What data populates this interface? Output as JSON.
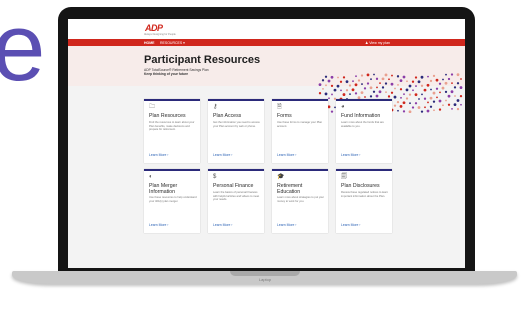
{
  "background_letter": "e",
  "laptop": {
    "label": "Laptop"
  },
  "site": {
    "logo": "ADP",
    "logo_tagline": "Always Designing for People",
    "nav": {
      "home": "HOME",
      "resources": "RESOURCES ▾",
      "plan": "♟ View my plan"
    }
  },
  "banner": {
    "title": "Participant Resources",
    "subtitle": "ADP TotalSource® Retirement Savings Plan",
    "tagline": "Keep thinking of your future"
  },
  "cards": [
    {
      "icon": "folder-icon",
      "glyph": "🗀",
      "title": "Plan Resources",
      "desc": "Find the resources to learn about your Plan benefits, make decisions and prepare for retirement.",
      "link": "Learn More ›"
    },
    {
      "icon": "key-icon",
      "glyph": "⚷",
      "title": "Plan Access",
      "desc": "Get the information you need to access your Plan account by web or phone.",
      "link": "Learn More ›"
    },
    {
      "icon": "document-icon",
      "glyph": "🗎",
      "title": "Forms",
      "desc": "Use these forms to manage your Plan account.",
      "link": "Learn More ›"
    },
    {
      "icon": "pie-icon",
      "glyph": "◕",
      "title": "Fund Information",
      "desc": "Learn more about the funds that are available to you.",
      "link": "Learn More ›"
    },
    {
      "icon": "merge-icon",
      "glyph": "◐",
      "title": "Plan Merger Information",
      "desc": "Use these resources to help understand your 401(k) plan merger.",
      "link": "Learn More ›"
    },
    {
      "icon": "dollar-icon",
      "glyph": "$",
      "title": "Personal Finance",
      "desc": "Learn the basics of personal finances with helpful articles and videos to meet your needs.",
      "link": "Learn More ›"
    },
    {
      "icon": "graduation-cap-icon",
      "glyph": "🎓",
      "title": "Retirement Education",
      "desc": "Learn more about strategies to put your money to work for you.",
      "link": "Learn More ›"
    },
    {
      "icon": "disclosure-doc-icon",
      "glyph": "🗐",
      "title": "Plan Disclosures",
      "desc": "Review these regulated notices to learn important information about the Plan.",
      "link": "Learn More ›"
    }
  ],
  "colors": {
    "brand_red": "#d0271d",
    "card_accent": "#2b2a7a",
    "link_blue": "#2b62b5",
    "banner_bg": "#f7ecea"
  }
}
